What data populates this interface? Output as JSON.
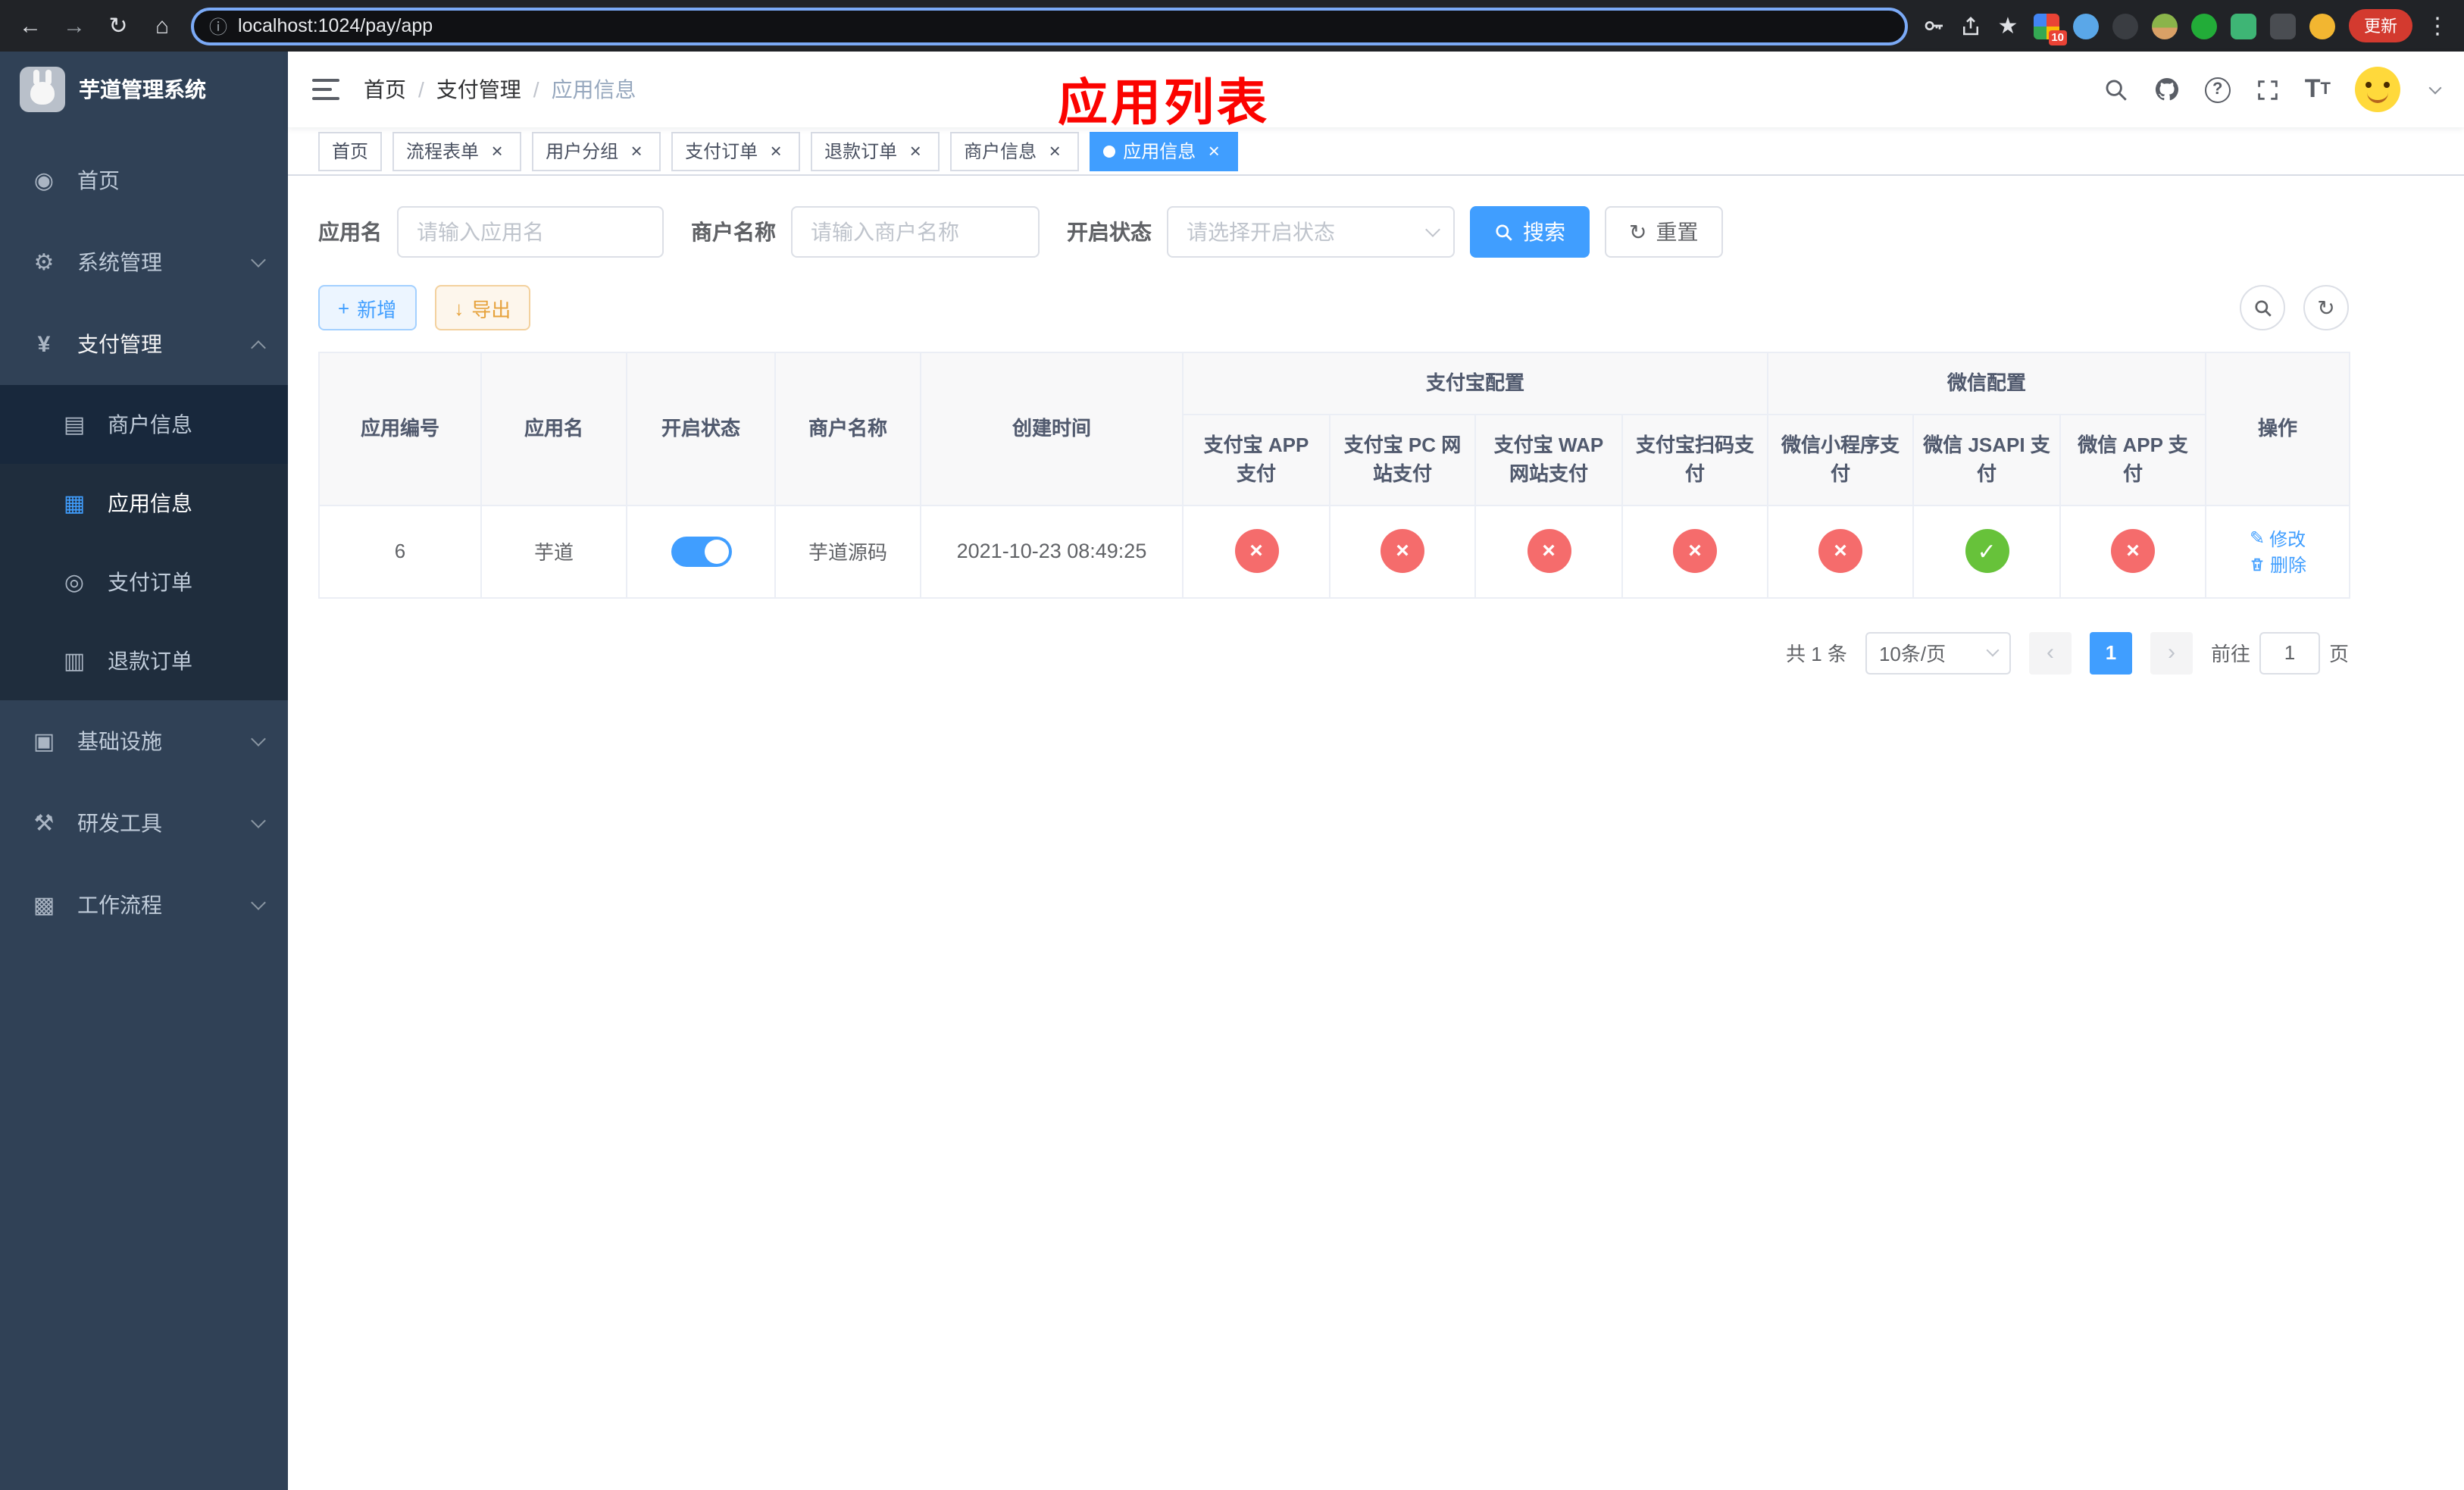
{
  "browser": {
    "url": "localhost:1024/pay/app",
    "update_label": "更新",
    "extension_badge": "10"
  },
  "icons": {
    "back": "←",
    "forward": "→",
    "reload": "↻",
    "home": "⌂",
    "info": "ⓘ",
    "star": "★",
    "more": "⋮",
    "close": "×",
    "question": "?",
    "font_big": "T",
    "font_small": "T",
    "plus": "+",
    "download": "↓",
    "refresh": "↻",
    "check": "✓",
    "cross": "×",
    "edit": "✎",
    "prev": "‹",
    "next": "›",
    "dashboard": "◉",
    "gear": "⚙",
    "yen": "¥",
    "merchant": "▤",
    "app": "▦",
    "order": "◎",
    "refund": "▥",
    "infra": "▣",
    "tools": "⚒",
    "workflow": "▩"
  },
  "sidebar": {
    "app_title": "芋道管理系统",
    "items": [
      {
        "label": "首页"
      },
      {
        "label": "系统管理"
      },
      {
        "label": "支付管理"
      },
      {
        "label": "基础设施"
      },
      {
        "label": "研发工具"
      },
      {
        "label": "工作流程"
      }
    ],
    "payment_children": [
      {
        "label": "商户信息"
      },
      {
        "label": "应用信息"
      },
      {
        "label": "支付订单"
      },
      {
        "label": "退款订单"
      }
    ]
  },
  "header": {
    "breadcrumb": [
      "首页",
      "支付管理",
      "应用信息"
    ],
    "annotation": "应用列表"
  },
  "tabs": [
    {
      "label": "首页",
      "closable": false,
      "active": false
    },
    {
      "label": "流程表单",
      "closable": true,
      "active": false
    },
    {
      "label": "用户分组",
      "closable": true,
      "active": false
    },
    {
      "label": "支付订单",
      "closable": true,
      "active": false
    },
    {
      "label": "退款订单",
      "closable": true,
      "active": false
    },
    {
      "label": "商户信息",
      "closable": true,
      "active": false
    },
    {
      "label": "应用信息",
      "closable": true,
      "active": true
    }
  ],
  "filters": {
    "app_name_label": "应用名",
    "app_name_placeholder": "请输入应用名",
    "merchant_label": "商户名称",
    "merchant_placeholder": "请输入商户名称",
    "status_label": "开启状态",
    "status_placeholder": "请选择开启状态",
    "search_button": "搜索",
    "reset_button": "重置"
  },
  "toolbar": {
    "add_button": "新增",
    "export_button": "导出"
  },
  "table": {
    "main_columns": [
      "应用编号",
      "应用名",
      "开启状态",
      "商户名称",
      "创建时间"
    ],
    "group_alipay": "支付宝配置",
    "group_wechat": "微信配置",
    "alipay_columns": [
      "支付宝 APP 支付",
      "支付宝 PC 网站支付",
      "支付宝 WAP 网站支付",
      "支付宝扫码支付"
    ],
    "wechat_columns": [
      "微信小程序支付",
      "微信 JSAPI 支付",
      "微信 APP 支付"
    ],
    "op_column": "操作",
    "row": {
      "id": "6",
      "name": "芋道",
      "enabled": true,
      "merchant": "芋道源码",
      "created_at": "2021-10-23 08:49:25",
      "channels": [
        false,
        false,
        false,
        false,
        false,
        true,
        false
      ],
      "edit_label": "修改",
      "delete_label": "删除"
    }
  },
  "pagination": {
    "total_text": "共 1 条",
    "page_size": "10条/页",
    "current_page": "1",
    "goto_label": "前往",
    "goto_value": "1",
    "goto_suffix": "页"
  },
  "colors": {
    "primary": "#409eff",
    "success": "#67c23a",
    "danger": "#f56c6c",
    "warning": "#e6a23c",
    "annotation": "#fb0300",
    "sidebar_bg": "#304156",
    "submenu_bg": "#1f2d3d"
  }
}
